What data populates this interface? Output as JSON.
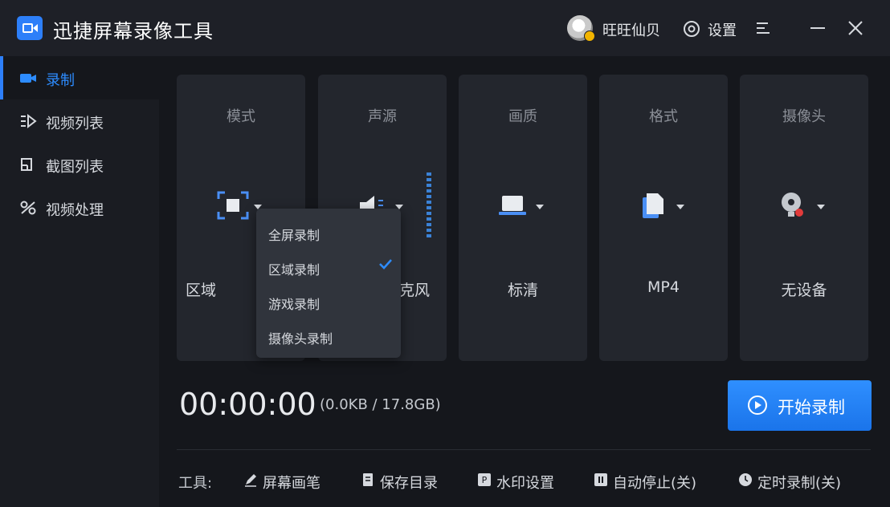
{
  "app": {
    "title": "迅捷屏幕录像工具"
  },
  "header": {
    "username": "旺旺仙贝",
    "settings_label": "设置"
  },
  "sidebar": {
    "items": [
      {
        "label": "录制",
        "icon": "camera-icon",
        "active": true
      },
      {
        "label": "视频列表",
        "icon": "video-list-icon",
        "active": false
      },
      {
        "label": "截图列表",
        "icon": "screenshot-list-icon",
        "active": false
      },
      {
        "label": "视频处理",
        "icon": "video-process-icon",
        "active": false
      }
    ]
  },
  "cards": [
    {
      "label": "模式",
      "value": "区域",
      "icon": "region-icon"
    },
    {
      "label": "声源",
      "value": "克风",
      "icon": "speaker-icon"
    },
    {
      "label": "画质",
      "value": "标清",
      "icon": "monitor-icon"
    },
    {
      "label": "格式",
      "value": "MP4",
      "icon": "file-icon"
    },
    {
      "label": "摄像头",
      "value": "无设备",
      "icon": "webcam-icon"
    }
  ],
  "mode_menu": {
    "options": [
      "全屏录制",
      "区域录制",
      "游戏录制",
      "摄像头录制"
    ],
    "selected": "区域录制"
  },
  "status": {
    "timer": "00:00:00",
    "size": "(0.0KB / 17.8GB)"
  },
  "record_button": {
    "label": "开始录制"
  },
  "tools": {
    "label": "工具:",
    "items": [
      {
        "label": "屏幕画笔",
        "icon": "pen-icon"
      },
      {
        "label": "保存目录",
        "icon": "folder-icon"
      },
      {
        "label": "水印设置",
        "icon": "watermark-icon"
      },
      {
        "label": "自动停止(关)",
        "icon": "pause-icon"
      },
      {
        "label": "定时录制(关)",
        "icon": "clock-icon"
      }
    ]
  },
  "colors": {
    "accent": "#2d7ff9",
    "background": "#15171c",
    "card": "#23262d"
  }
}
